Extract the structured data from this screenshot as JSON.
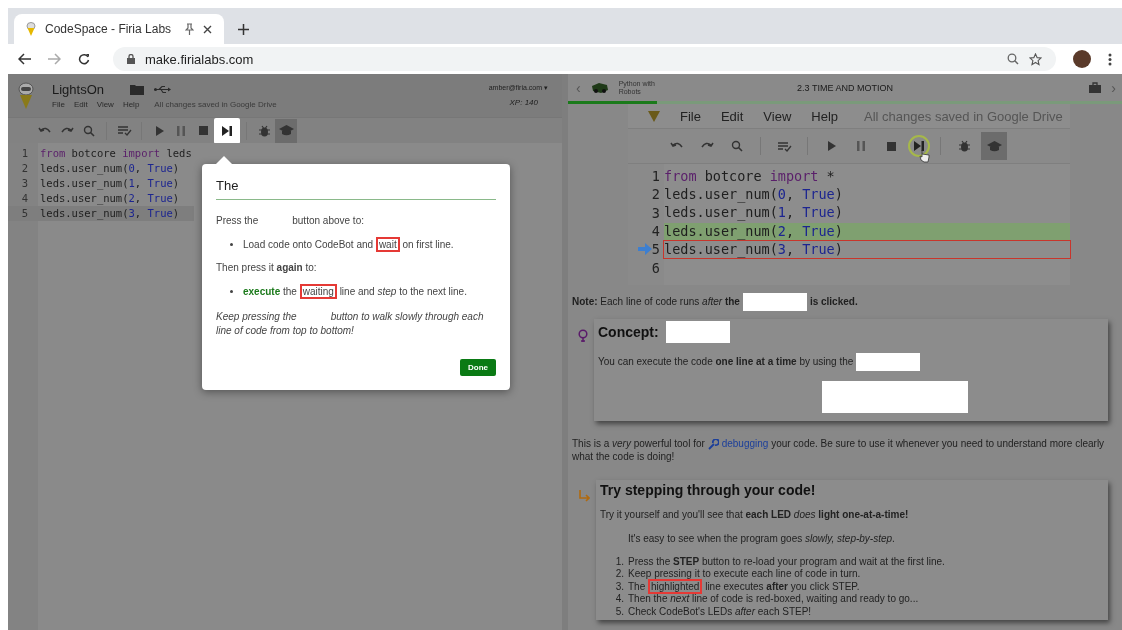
{
  "browser": {
    "tab": {
      "title": "CodeSpace - Firia Labs"
    },
    "address": "make.firialabs.com"
  },
  "left": {
    "project": "LightsOn",
    "menu": [
      "File",
      "Edit",
      "View",
      "Help"
    ],
    "save_status": "All changes saved in Google Drive",
    "user": "amber@firia.com ▾",
    "xp": "XP: 140",
    "toolbar": [
      {
        "kind": "undo",
        "highlighted": false,
        "active": false
      },
      {
        "kind": "redo",
        "highlighted": false,
        "active": false
      },
      {
        "kind": "search",
        "highlighted": false,
        "active": false
      },
      {
        "kind": "format",
        "highlighted": false,
        "active": false
      },
      {
        "kind": "run",
        "highlighted": false,
        "active": false
      },
      {
        "kind": "pause",
        "highlighted": false,
        "active": false
      },
      {
        "kind": "stop",
        "highlighted": false,
        "active": false
      },
      {
        "kind": "step",
        "highlighted": true,
        "active": false
      },
      {
        "kind": "debug",
        "highlighted": false,
        "active": false
      },
      {
        "kind": "learn",
        "highlighted": false,
        "active": true
      }
    ],
    "code": [
      {
        "number": "1",
        "selected": false,
        "tokens": [
          {
            "kind": "keyword",
            "text": "from"
          },
          {
            "kind": "plain",
            "text": " botcore "
          },
          {
            "kind": "keyword",
            "text": "import"
          },
          {
            "kind": "plain",
            "text": " leds"
          }
        ]
      },
      {
        "number": "2",
        "selected": false,
        "tokens": [
          {
            "kind": "plain",
            "text": "leds.user_num("
          },
          {
            "kind": "number",
            "text": "0"
          },
          {
            "kind": "plain",
            "text": ", "
          },
          {
            "kind": "constant",
            "text": "True"
          },
          {
            "kind": "plain",
            "text": ")"
          }
        ]
      },
      {
        "number": "3",
        "selected": false,
        "tokens": [
          {
            "kind": "plain",
            "text": "leds.user_num("
          },
          {
            "kind": "number",
            "text": "1"
          },
          {
            "kind": "plain",
            "text": ", "
          },
          {
            "kind": "constant",
            "text": "True"
          },
          {
            "kind": "plain",
            "text": ")"
          }
        ]
      },
      {
        "number": "4",
        "selected": false,
        "tokens": [
          {
            "kind": "plain",
            "text": "leds.user_num("
          },
          {
            "kind": "number",
            "text": "2"
          },
          {
            "kind": "plain",
            "text": ", "
          },
          {
            "kind": "constant",
            "text": "True"
          },
          {
            "kind": "plain",
            "text": ")"
          }
        ]
      },
      {
        "number": "5",
        "selected": true,
        "tokens": [
          {
            "kind": "plain",
            "text": "leds.user_num("
          },
          {
            "kind": "number",
            "text": "3"
          },
          {
            "kind": "plain",
            "text": ", "
          },
          {
            "kind": "constant",
            "text": "True"
          },
          {
            "kind": "plain",
            "text": ")"
          }
        ]
      }
    ]
  },
  "popup": {
    "title": "The",
    "button": "Done",
    "paragraphs": [
      {
        "kind": "plain",
        "parts": [
          {
            "kind": "text",
            "text": "Press the"
          },
          {
            "kind": "gap"
          },
          {
            "kind": "text",
            "text": "button above to:"
          }
        ]
      },
      {
        "kind": "bullet",
        "parts": [
          {
            "kind": "text",
            "text": "Load code onto CodeBot and "
          },
          {
            "kind": "boxed",
            "text": "wait"
          },
          {
            "kind": "text",
            "text": " on first line."
          }
        ]
      },
      {
        "kind": "plain",
        "parts": [
          {
            "kind": "text",
            "text": "Then press it **again** to:"
          }
        ]
      },
      {
        "kind": "bullet",
        "parts": [
          {
            "kind": "accent",
            "text": "execute"
          },
          {
            "kind": "text",
            "text": " the "
          },
          {
            "kind": "boxed",
            "text": "waiting"
          },
          {
            "kind": "text",
            "text": " line and *step* to the next line."
          }
        ]
      },
      {
        "kind": "note",
        "parts": [
          {
            "kind": "text",
            "text": "Keep pressing the"
          },
          {
            "kind": "gap"
          },
          {
            "kind": "text",
            "text": "button to walk slowly through each line of code from top to bottom!"
          }
        ]
      }
    ]
  },
  "right": {
    "prev": "‹",
    "next": "›",
    "course": "Python with Robots",
    "lesson": "2.3 TIME AND MOTION",
    "progress": {
      "level": 0.16
    },
    "editor": {
      "menu": [
        "File",
        "Edit",
        "View",
        "Help"
      ],
      "save_status": "All changes saved in Google Drive",
      "toolbar": [
        {
          "kind": "undo",
          "highlighted": false,
          "active": false
        },
        {
          "kind": "redo",
          "highlighted": false,
          "active": false
        },
        {
          "kind": "search",
          "highlighted": false,
          "active": false
        },
        {
          "kind": "format",
          "highlighted": false,
          "active": false
        },
        {
          "kind": "run",
          "highlighted": false,
          "active": false
        },
        {
          "kind": "pause",
          "highlighted": false,
          "active": false
        },
        {
          "kind": "stop",
          "highlighted": false,
          "active": false
        },
        {
          "kind": "step",
          "highlighted": true,
          "active": false
        },
        {
          "kind": "debug",
          "highlighted": false,
          "active": false
        },
        {
          "kind": "learn",
          "highlighted": false,
          "active": true
        }
      ],
      "code": [
        {
          "number": "1",
          "executed": false,
          "current": false,
          "tokens": [
            {
              "kind": "keyword",
              "text": "from"
            },
            {
              "kind": "plain",
              "text": " botcore "
            },
            {
              "kind": "keyword",
              "text": "import"
            },
            {
              "kind": "plain",
              "text": " *"
            }
          ]
        },
        {
          "number": "2",
          "executed": false,
          "current": false,
          "tokens": [
            {
              "kind": "plain",
              "text": "leds.user_num("
            },
            {
              "kind": "number",
              "text": "0"
            },
            {
              "kind": "plain",
              "text": ", "
            },
            {
              "kind": "constant",
              "text": "True"
            },
            {
              "kind": "plain",
              "text": ")"
            }
          ]
        },
        {
          "number": "3",
          "executed": false,
          "current": false,
          "tokens": [
            {
              "kind": "plain",
              "text": "leds.user_num("
            },
            {
              "kind": "number",
              "text": "1"
            },
            {
              "kind": "plain",
              "text": ", "
            },
            {
              "kind": "constant",
              "text": "True"
            },
            {
              "kind": "plain",
              "text": ")"
            }
          ]
        },
        {
          "number": "4",
          "executed": true,
          "current": false,
          "tokens": [
            {
              "kind": "plain",
              "text": "leds.user_num("
            },
            {
              "kind": "number",
              "text": "2"
            },
            {
              "kind": "plain",
              "text": ", "
            },
            {
              "kind": "constant",
              "text": "True"
            },
            {
              "kind": "plain",
              "text": ")"
            }
          ]
        },
        {
          "number": "5",
          "executed": false,
          "current": true,
          "tokens": [
            {
              "kind": "plain",
              "text": "leds.user_num("
            },
            {
              "kind": "number",
              "text": "3"
            },
            {
              "kind": "plain",
              "text": ", "
            },
            {
              "kind": "constant",
              "text": "True"
            },
            {
              "kind": "plain",
              "text": ")"
            }
          ]
        },
        {
          "number": "6"
        }
      ]
    },
    "note": {
      "parts": [
        {
          "kind": "text",
          "text": "**Note:** Each line of code runs *after* **the**"
        },
        {
          "kind": "blank"
        },
        {
          "kind": "text",
          "text": "**is clicked.**"
        }
      ]
    },
    "concept": {
      "title": "Concept:",
      "parts": [
        {
          "kind": "text",
          "text": "You can execute the code **one line at a time** by using the"
        },
        {
          "kind": "blank"
        }
      ]
    },
    "debug_text": {
      "parts": [
        {
          "kind": "text",
          "text": "This is a *very* powerful tool for "
        },
        {
          "kind": "link",
          "text": "debugging"
        },
        {
          "kind": "text",
          "text": " your code. Be sure to use it whenever you need to understand more clearly what the code is doing!"
        }
      ]
    },
    "exercise": {
      "title": "Try stepping through your code!",
      "paragraphs": [
        {
          "kind": "plain",
          "parts": [
            {
              "kind": "text",
              "text": "Try it yourself and you'll see that **each LED** *does* **light one-at-a-time!**"
            }
          ]
        },
        {
          "kind": "indent",
          "parts": [
            {
              "kind": "text",
              "text": "It's easy to see when the program goes *slowly, step-by-step*."
            }
          ]
        }
      ],
      "steps": [
        {
          "number": "1.",
          "parts": [
            {
              "kind": "text",
              "text": "Press the **STEP** button to re-load your program and wait at the first line."
            }
          ]
        },
        {
          "number": "2.",
          "parts": [
            {
              "kind": "text",
              "text": "Keep pressing it to execute each line of code in turn."
            }
          ]
        },
        {
          "number": "3.",
          "parts": [
            {
              "kind": "text",
              "text": "The "
            },
            {
              "kind": "boxed",
              "text": "highlighted"
            },
            {
              "kind": "text",
              "text": " line executes **after** you click STEP."
            }
          ]
        },
        {
          "number": "4.",
          "parts": [
            {
              "kind": "text",
              "text": "Then the *next* line of code is red-boxed, waiting and ready to go..."
            }
          ]
        },
        {
          "number": "5.",
          "parts": [
            {
              "kind": "text",
              "text": "Check CodeBot's LEDs *after* each STEP!"
            }
          ]
        }
      ]
    }
  }
}
